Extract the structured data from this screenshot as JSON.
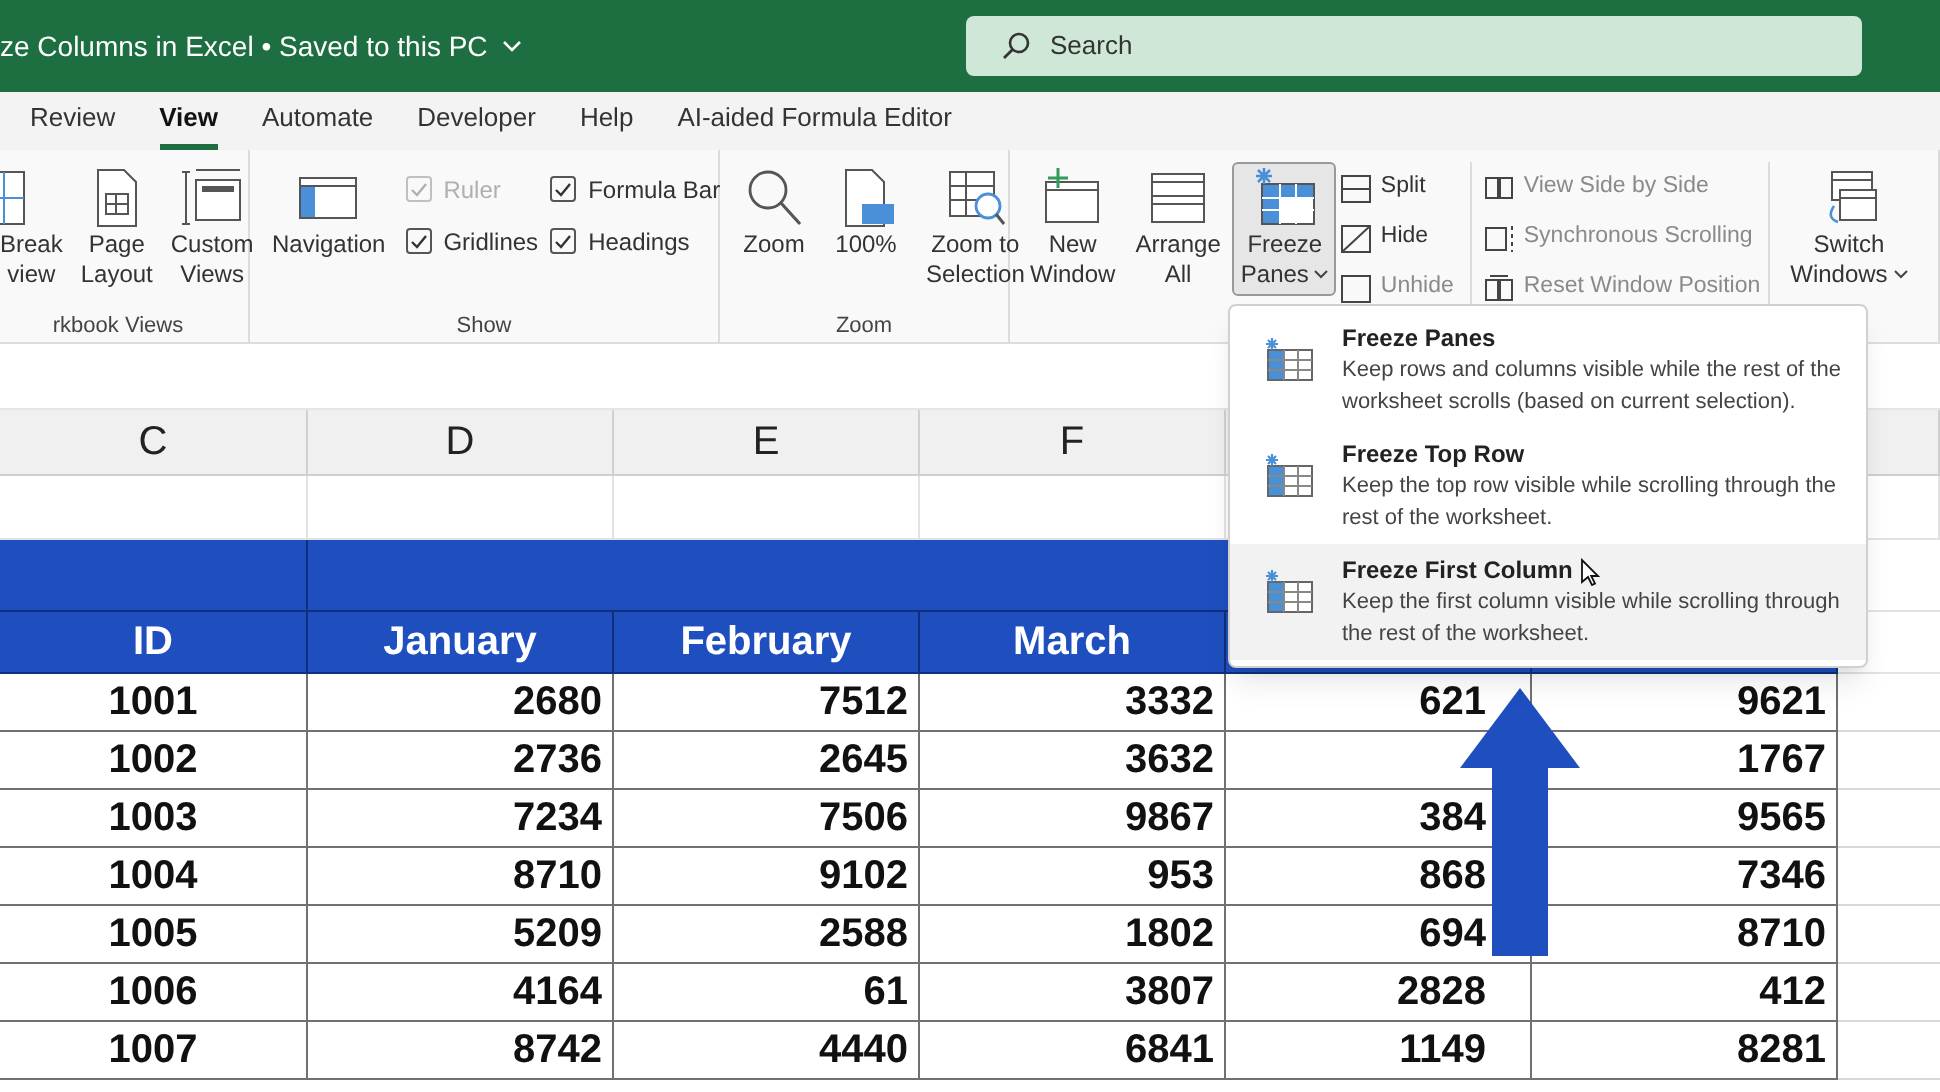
{
  "title_bar": {
    "title": "ze Columns in Excel • Saved to this PC",
    "search_placeholder": "Search"
  },
  "tabs": [
    {
      "label": "Review",
      "selected": false
    },
    {
      "label": "View",
      "selected": true
    },
    {
      "label": "Automate",
      "selected": false
    },
    {
      "label": "Developer",
      "selected": false
    },
    {
      "label": "Help",
      "selected": false
    },
    {
      "label": "AI-aided Formula Editor",
      "selected": false
    }
  ],
  "ribbon_groups": [
    {
      "label": "rkbook Views",
      "controls": [
        {
          "kind": "large",
          "lines": [
            "Break",
            "view"
          ]
        },
        {
          "kind": "large",
          "lines": [
            "Page",
            "Layout"
          ]
        },
        {
          "kind": "large",
          "lines": [
            "Custom",
            "Views"
          ]
        }
      ]
    },
    {
      "label": "Show",
      "controls": [
        {
          "kind": "large",
          "lines": [
            "Navigation"
          ]
        },
        {
          "kind": "stack",
          "items": [
            {
              "kind": "checkbox",
              "label": "Ruler",
              "checked": true,
              "disabled": true
            },
            {
              "kind": "checkbox",
              "label": "Gridlines",
              "checked": true,
              "disabled": false
            }
          ]
        },
        {
          "kind": "stack",
          "items": [
            {
              "kind": "checkbox",
              "label": "Formula Bar",
              "checked": true,
              "disabled": false
            },
            {
              "kind": "checkbox",
              "label": "Headings",
              "checked": true,
              "disabled": false
            }
          ]
        }
      ]
    },
    {
      "label": "Zoom",
      "controls": [
        {
          "kind": "large",
          "lines": [
            "Zoom"
          ]
        },
        {
          "kind": "large",
          "lines": [
            "100%"
          ]
        },
        {
          "kind": "large",
          "lines": [
            "Zoom to",
            "Selection"
          ]
        }
      ]
    },
    {
      "controls": [
        {
          "kind": "large",
          "lines": [
            "New",
            "Window"
          ]
        },
        {
          "kind": "large",
          "lines": [
            "Arrange",
            "All"
          ]
        },
        {
          "kind": "large",
          "lines": [
            "Freeze",
            "Panes"
          ],
          "pressed": true,
          "menu": true
        },
        {
          "kind": "stack",
          "items": [
            {
              "kind": "small",
              "label": "Split",
              "disabled": false
            },
            {
              "kind": "small",
              "label": "Hide",
              "disabled": false
            },
            {
              "kind": "small",
              "label": "Unhide",
              "disabled": true
            }
          ]
        },
        {
          "kind": "stack",
          "items": [
            {
              "kind": "small",
              "label": "View Side by Side",
              "disabled": true
            },
            {
              "kind": "small",
              "label": "Synchronous Scrolling",
              "disabled": true
            },
            {
              "kind": "small",
              "label": "Reset Window Position",
              "disabled": true
            }
          ]
        },
        {
          "kind": "large",
          "lines": [
            "Switch",
            "Windows"
          ],
          "pressed": false,
          "menu": true
        }
      ]
    }
  ],
  "freeze_menu": [
    {
      "title": "Freeze Panes",
      "description": "Keep rows and columns visible while the rest of the worksheet scrolls (based on current selection).",
      "selected": false
    },
    {
      "title": "Freeze Top Row",
      "description": "Keep the top row visible while scrolling through the rest of the worksheet.",
      "selected": false
    },
    {
      "title": "Freeze First Column",
      "description": "Keep the first column visible while scrolling through the rest of the worksheet.",
      "selected": true
    }
  ],
  "sheet": {
    "column_headers": [
      "C",
      "D",
      "E",
      "F"
    ],
    "table_headers": [
      "ID",
      "January",
      "February",
      "March"
    ],
    "rows": [
      [
        "1001",
        "2680",
        "7512",
        "3332",
        "621",
        "9621"
      ],
      [
        "1002",
        "2736",
        "2645",
        "3632",
        null,
        "1767"
      ],
      [
        "1003",
        "7234",
        "7506",
        "9867",
        "384",
        "9565"
      ],
      [
        "1004",
        "8710",
        "9102",
        "953",
        "868",
        "7346"
      ],
      [
        "1005",
        "5209",
        "2588",
        "1802",
        "694",
        "8710"
      ],
      [
        "1006",
        "4164",
        "61",
        "3807",
        "2828",
        "412"
      ],
      [
        "1007",
        "8742",
        "4440",
        "6841",
        "1149",
        "8281"
      ]
    ]
  }
}
